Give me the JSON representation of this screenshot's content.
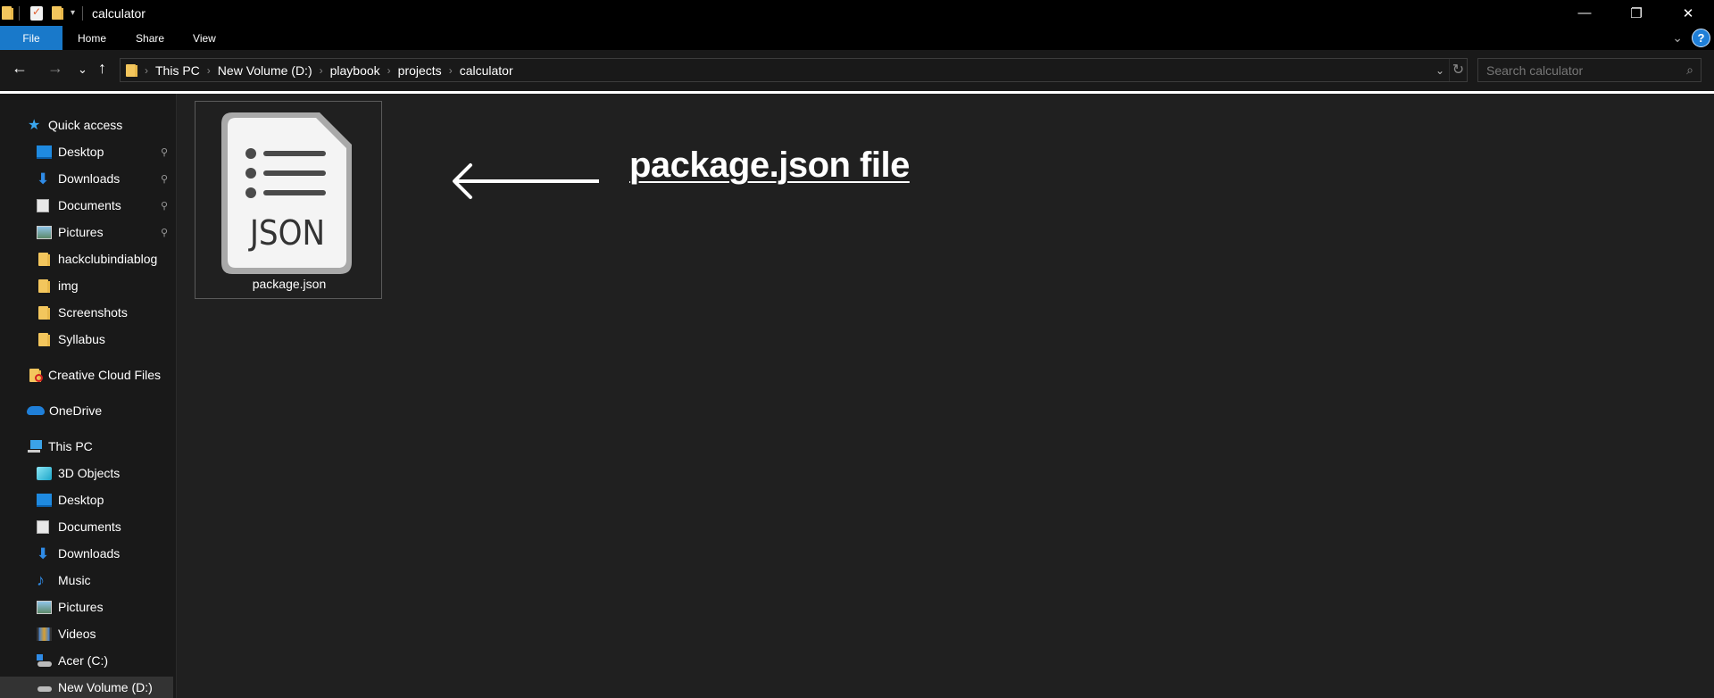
{
  "window": {
    "title": "calculator",
    "controls": {
      "minimize": "—",
      "restore": "❐",
      "close": "✕"
    }
  },
  "quick_access_toolbar": {
    "icons": [
      "folder-icon",
      "properties-icon",
      "new-folder-icon",
      "customize-dropdown-icon"
    ]
  },
  "ribbon": {
    "tabs": [
      {
        "label": "File",
        "active": true
      },
      {
        "label": "Home"
      },
      {
        "label": "Share"
      },
      {
        "label": "View"
      }
    ],
    "expand_icon": "⌄",
    "help_icon": "?"
  },
  "navigation": {
    "back": "←",
    "forward": "→",
    "recent": "⌄",
    "up": "↑"
  },
  "address_bar": {
    "breadcrumbs": [
      "This PC",
      "New Volume (D:)",
      "playbook",
      "projects",
      "calculator"
    ],
    "separator": "›",
    "dropdown": "⌄",
    "refresh": "↻"
  },
  "search": {
    "placeholder": "Search calculator",
    "value": "",
    "icon": "⌕"
  },
  "sidebar": {
    "quick_access": {
      "label": "Quick access",
      "items": [
        {
          "label": "Desktop",
          "icon": "desktop-icon",
          "pinned": true
        },
        {
          "label": "Downloads",
          "icon": "downloads-icon",
          "pinned": true
        },
        {
          "label": "Documents",
          "icon": "documents-icon",
          "pinned": true
        },
        {
          "label": "Pictures",
          "icon": "pictures-icon",
          "pinned": true
        },
        {
          "label": "hackclubindiablog",
          "icon": "folder-icon",
          "pinned": false
        },
        {
          "label": "img",
          "icon": "folder-icon",
          "pinned": false
        },
        {
          "label": "Screenshots",
          "icon": "folder-icon",
          "pinned": false
        },
        {
          "label": "Syllabus",
          "icon": "folder-icon",
          "pinned": false
        }
      ]
    },
    "creative_cloud": {
      "label": "Creative Cloud Files"
    },
    "onedrive": {
      "label": "OneDrive"
    },
    "this_pc": {
      "label": "This PC",
      "items": [
        {
          "label": "3D Objects",
          "icon": "3d-objects-icon"
        },
        {
          "label": "Desktop",
          "icon": "desktop-icon"
        },
        {
          "label": "Documents",
          "icon": "documents-icon"
        },
        {
          "label": "Downloads",
          "icon": "downloads-icon"
        },
        {
          "label": "Music",
          "icon": "music-icon"
        },
        {
          "label": "Pictures",
          "icon": "pictures-icon"
        },
        {
          "label": "Videos",
          "icon": "videos-icon"
        },
        {
          "label": "Acer (C:)",
          "icon": "drive-c-icon"
        },
        {
          "label": "New Volume (D:)",
          "icon": "drive-d-icon",
          "selected": true
        }
      ]
    },
    "pin_glyph": "📌"
  },
  "files": [
    {
      "name": "package.json",
      "type_label": "JSON"
    }
  ],
  "annotation": {
    "text": "package.json file",
    "arrow": "←"
  },
  "colors": {
    "accent": "#1979ca",
    "folder": "#f3c65d",
    "background": "#202020",
    "sidebar": "#191919"
  }
}
